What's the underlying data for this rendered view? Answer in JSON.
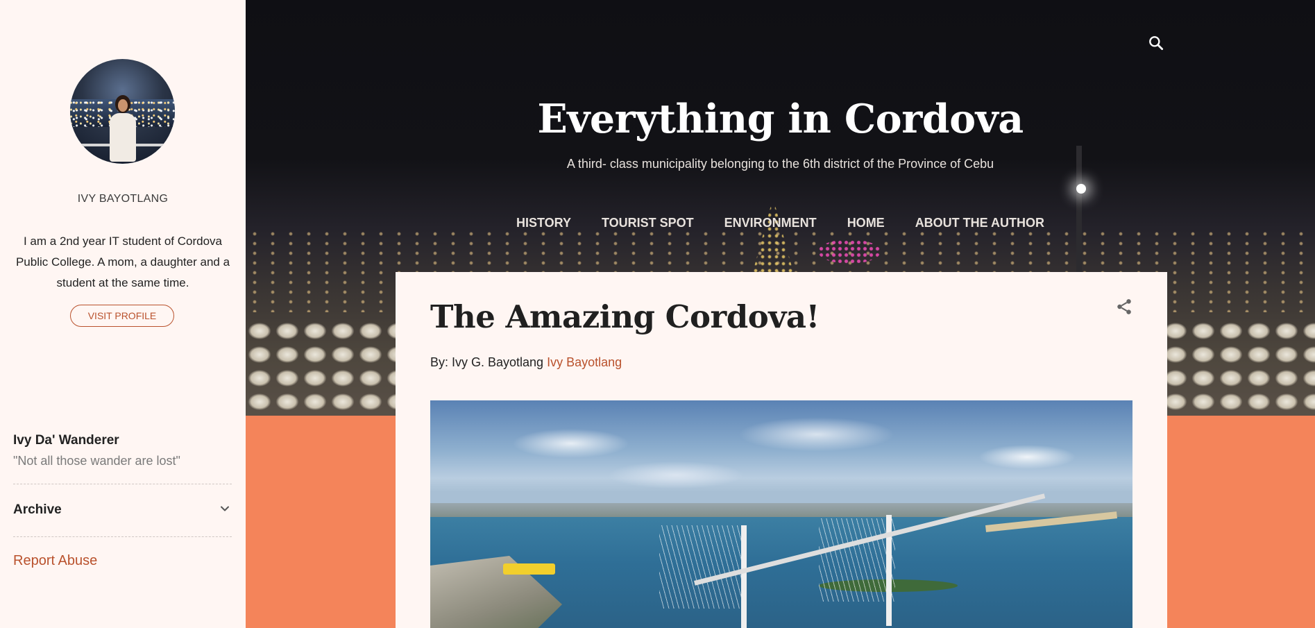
{
  "sidebar": {
    "profile_name": "IVY BAYOTLANG",
    "bio": "I am a 2nd year IT student of Cordova Public College. A mom, a daughter and a student at the same time.",
    "visit_profile_label": "VISIT PROFILE",
    "blog_name": "Ivy Da' Wanderer",
    "blog_tagline": "\"Not all those wander are lost\"",
    "archive_label": "Archive",
    "report_abuse_label": "Report Abuse"
  },
  "header": {
    "title": "Everything in Cordova",
    "description": "A third- class municipality belonging to the 6th district of the Province of Cebu",
    "nav": [
      {
        "label": "HISTORY"
      },
      {
        "label": "TOURIST SPOT"
      },
      {
        "label": "ENVIRONMENT"
      },
      {
        "label": "HOME"
      },
      {
        "label": "ABOUT THE AUTHOR"
      }
    ]
  },
  "post": {
    "title": "The Amazing Cordova!",
    "byline_prefix": "By: Ivy G. Bayotlang ",
    "byline_link": "Ivy Bayotlang"
  },
  "icons": {
    "search": "search-icon",
    "share": "share-icon",
    "archive_toggle": "chevron-down-icon"
  },
  "colors": {
    "accent": "#b9512c",
    "page_background": "#f4845a",
    "sidebar_background": "#fff6f3",
    "card_background": "#fff6f3"
  }
}
